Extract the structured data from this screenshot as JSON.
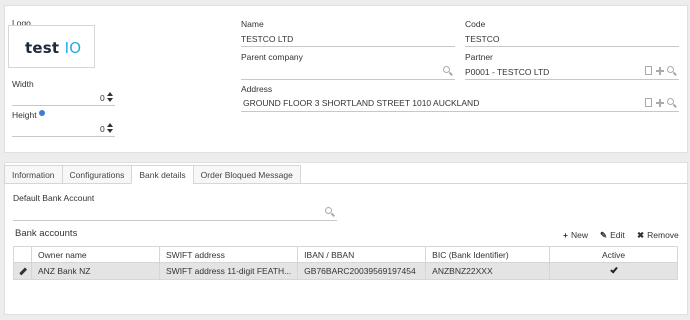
{
  "form": {
    "logo": {
      "label": "Logo",
      "brand_main": "test ",
      "brand_accent": "IO"
    },
    "width": {
      "label": "Width",
      "value": "0"
    },
    "height": {
      "label": "Height",
      "value": "0"
    },
    "name": {
      "label": "Name",
      "value": "TESTCO LTD"
    },
    "code": {
      "label": "Code",
      "value": "TESTCO"
    },
    "parent_company": {
      "label": "Parent company",
      "value": ""
    },
    "partner": {
      "label": "Partner",
      "value": "P0001 - TESTCO LTD"
    },
    "address": {
      "label": "Address",
      "value": "GROUND FLOOR 3 SHORTLAND STREET 1010 AUCKLAND"
    }
  },
  "tabs": [
    {
      "label": "Information"
    },
    {
      "label": "Configurations"
    },
    {
      "label": "Bank details"
    },
    {
      "label": "Order Bloqued Message"
    }
  ],
  "active_tab": "Bank details",
  "bank_details": {
    "default_bank_account": {
      "label": "Default Bank Account",
      "value": ""
    },
    "section_title": "Bank accounts",
    "actions": {
      "new": "New",
      "edit": "Edit",
      "remove": "Remove"
    },
    "columns": [
      "Owner name",
      "SWIFT address",
      "IBAN / BBAN",
      "BIC (Bank Identifier)",
      "Active"
    ],
    "rows": [
      {
        "owner_name": "ANZ Bank NZ",
        "swift_address": "SWIFT address 11-digit FEATH...",
        "iban": "GB76BARC20039569197454",
        "bic": "ANZBNZ22XXX",
        "active": true
      }
    ]
  },
  "colors": {
    "accent": "#27a9e1",
    "brand_dark": "#1e2a3a",
    "info": "#3d7ec8",
    "row_selected": "#e4e4e4"
  },
  "icons": [
    "search-icon",
    "document-icon",
    "plus-icon",
    "pencil-icon",
    "x-icon",
    "check-icon",
    "info-icon",
    "spinner-icon"
  ]
}
